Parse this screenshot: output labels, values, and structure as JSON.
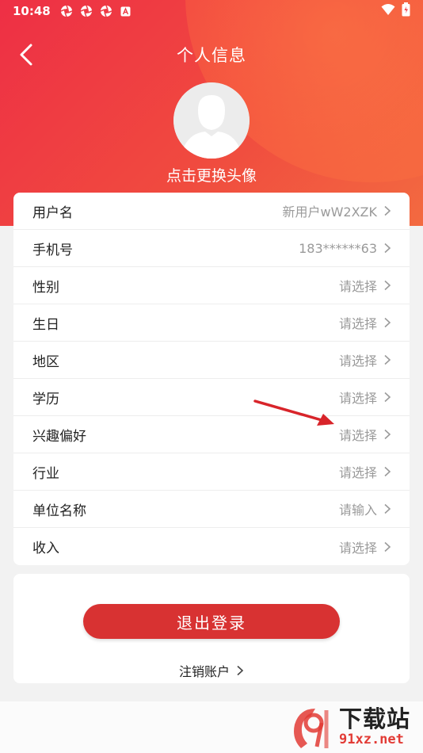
{
  "status_bar": {
    "time": "10:48",
    "left_icons": [
      "aperture-icon",
      "aperture-icon",
      "aperture-icon",
      "a-icon"
    ],
    "right_icons": [
      "wifi-icon",
      "battery-icon"
    ]
  },
  "header": {
    "title": "个人信息",
    "avatar_hint": "点击更换头像",
    "gradient_colors": [
      "#ee2f45",
      "#f36a40"
    ]
  },
  "profile_rows": [
    {
      "label": "用户名",
      "value": "新用户wW2XZK"
    },
    {
      "label": "手机号",
      "value": "183******63"
    },
    {
      "label": "性别",
      "value": "请选择"
    },
    {
      "label": "生日",
      "value": "请选择"
    },
    {
      "label": "地区",
      "value": "请选择"
    },
    {
      "label": "学历",
      "value": "请选择"
    },
    {
      "label": "兴趣偏好",
      "value": "请选择"
    },
    {
      "label": "行业",
      "value": "请选择"
    },
    {
      "label": "单位名称",
      "value": "请输入"
    },
    {
      "label": "收入",
      "value": "请选择"
    }
  ],
  "actions": {
    "logout_label": "退出登录",
    "cancel_account_label": "注销账户",
    "logout_color": "#d83232"
  },
  "watermark": {
    "title": "下载站",
    "url": "91xz.net"
  }
}
